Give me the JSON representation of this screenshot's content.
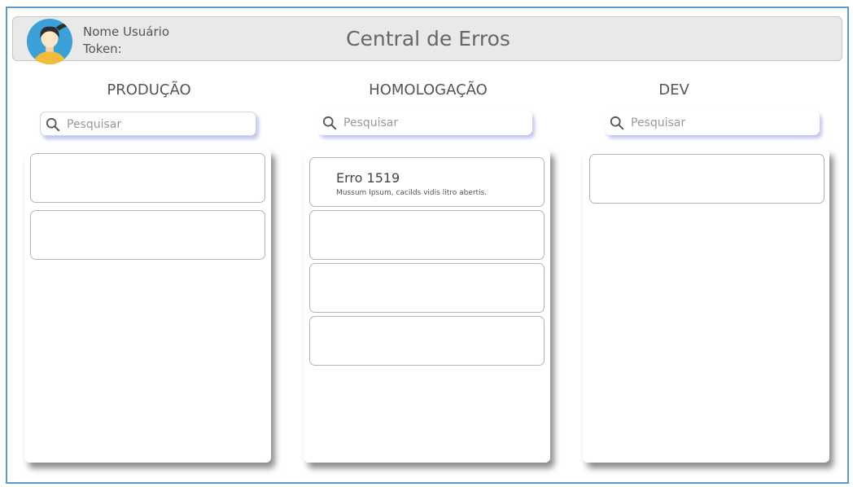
{
  "header": {
    "user_name": "Nome Usuário",
    "token_label": "Token:",
    "title": "Central de Erros",
    "avatar_icon": "user-avatar-icon",
    "avatar_colors": {
      "background": "#3aa0d8",
      "hair": "#2d2d2d",
      "skin": "#fde5c8",
      "shirt": "#f2bb3a"
    }
  },
  "columns": [
    {
      "title": "PRODUÇÃO",
      "search_placeholder": "Pesquisar",
      "cards": [
        {
          "title": "",
          "description": ""
        },
        {
          "title": "",
          "description": ""
        }
      ]
    },
    {
      "title": "HOMOLOGAÇÃO",
      "search_placeholder": "Pesquisar",
      "cards": [
        {
          "title": "Erro 1519",
          "description": "Mussum Ipsum, cacilds vidis litro abertis."
        },
        {
          "title": "",
          "description": ""
        },
        {
          "title": "",
          "description": ""
        },
        {
          "title": "",
          "description": ""
        }
      ]
    },
    {
      "title": "DEV",
      "search_placeholder": "Pesquisar",
      "cards": [
        {
          "title": "",
          "description": ""
        }
      ]
    }
  ],
  "colors": {
    "frame_border": "#5b9bd5",
    "header_bg": "#e9e9e9",
    "search_shadow": "#aaafe6"
  }
}
